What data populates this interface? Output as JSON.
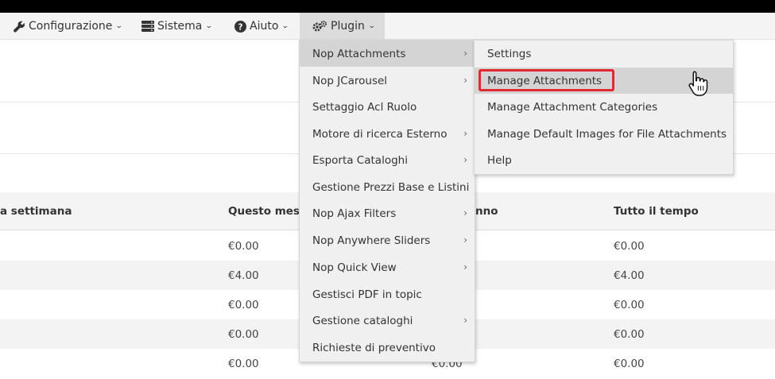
{
  "navbar": {
    "items": [
      {
        "label": "Configurazione",
        "icon": "wrench-icon"
      },
      {
        "label": "Sistema",
        "icon": "server-icon"
      },
      {
        "label": "Aiuto",
        "icon": "question-circle-icon"
      },
      {
        "label": "Plugin",
        "icon": "gears-icon"
      }
    ]
  },
  "table": {
    "headers": [
      "a settimana",
      "Questo mese",
      "nno",
      "Tutto il tempo"
    ],
    "rows": [
      {
        "month": "€0.00",
        "year": "",
        "all": "€0.00"
      },
      {
        "month": "€4.00",
        "year": "",
        "all": "€4.00"
      },
      {
        "month": "€0.00",
        "year": "",
        "all": "€0.00"
      },
      {
        "month": "€0.00",
        "year": "",
        "all": "€0.00"
      },
      {
        "month": "€0.00",
        "year": "€0.00",
        "all": "€0.00"
      }
    ]
  },
  "plugin_menu": {
    "items": [
      {
        "label": "Nop Attachments",
        "submenu": true
      },
      {
        "label": "Nop JCarousel",
        "submenu": true
      },
      {
        "label": "Settaggio Acl Ruolo",
        "submenu": false
      },
      {
        "label": "Motore di ricerca Esterno",
        "submenu": true
      },
      {
        "label": "Esporta Cataloghi",
        "submenu": true
      },
      {
        "label": "Gestione Prezzi Base e Listini",
        "submenu": false
      },
      {
        "label": "Nop Ajax Filters",
        "submenu": true
      },
      {
        "label": "Nop Anywhere Sliders",
        "submenu": true
      },
      {
        "label": "Nop Quick View",
        "submenu": true
      },
      {
        "label": "Gestisci PDF in topic",
        "submenu": false
      },
      {
        "label": "Gestione cataloghi",
        "submenu": true
      },
      {
        "label": "Richieste di preventivo",
        "submenu": false
      }
    ]
  },
  "attachments_submenu": {
    "items": [
      "Settings",
      "Manage Attachments",
      "Manage Attachment Categories",
      "Manage Default Images for File Attachments",
      "Help"
    ]
  },
  "colors": {
    "highlight_border": "#e0282f",
    "menu_background": "#f0f0f0",
    "menu_highlight": "#d4d4d4"
  }
}
